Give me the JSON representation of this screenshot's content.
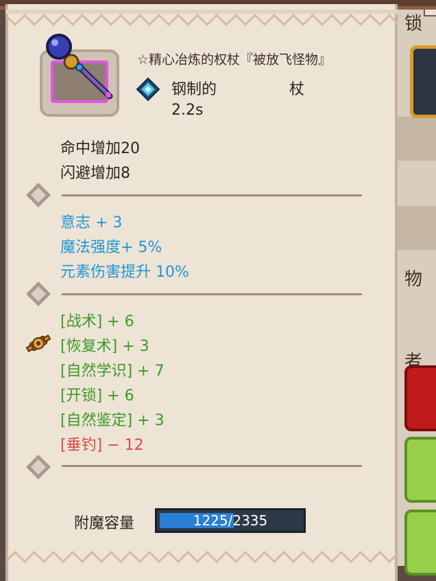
{
  "item": {
    "title": "☆精心冶炼的权杖『被放飞怪物』",
    "material": "钢制的",
    "weapon_type": "杖",
    "speed": "2.2s"
  },
  "base_stats": [
    "命中增加20",
    "闪避增加8"
  ],
  "attribute_stats": [
    "意志 + 3",
    "魔法强度+ 5%",
    "元素伤害提升 10%"
  ],
  "skill_stats": [
    {
      "text": "[战术] + 6",
      "color": "#3c9a2a"
    },
    {
      "text": "[恢复术] + 3",
      "color": "#3c9a2a"
    },
    {
      "text": "[自然学识] + 7",
      "color": "#3c9a2a"
    },
    {
      "text": "[开锁] + 6",
      "color": "#3c9a2a"
    },
    {
      "text": "[自然鉴定] + 3",
      "color": "#3c9a2a"
    },
    {
      "text": "[垂钓] − 12",
      "color": "#d94a4a"
    }
  ],
  "enchant": {
    "label": "附魔容量",
    "current": 1225,
    "max": 2335,
    "text": "1225/2335"
  },
  "background": {
    "text1": "锁",
    "text2": "物",
    "text3": "者"
  },
  "colors": {
    "accent_blue": "#2196d6",
    "bonus_green": "#3c9a2a",
    "penalty_red": "#d94a4a",
    "rarity_frame": "#e055e8"
  }
}
